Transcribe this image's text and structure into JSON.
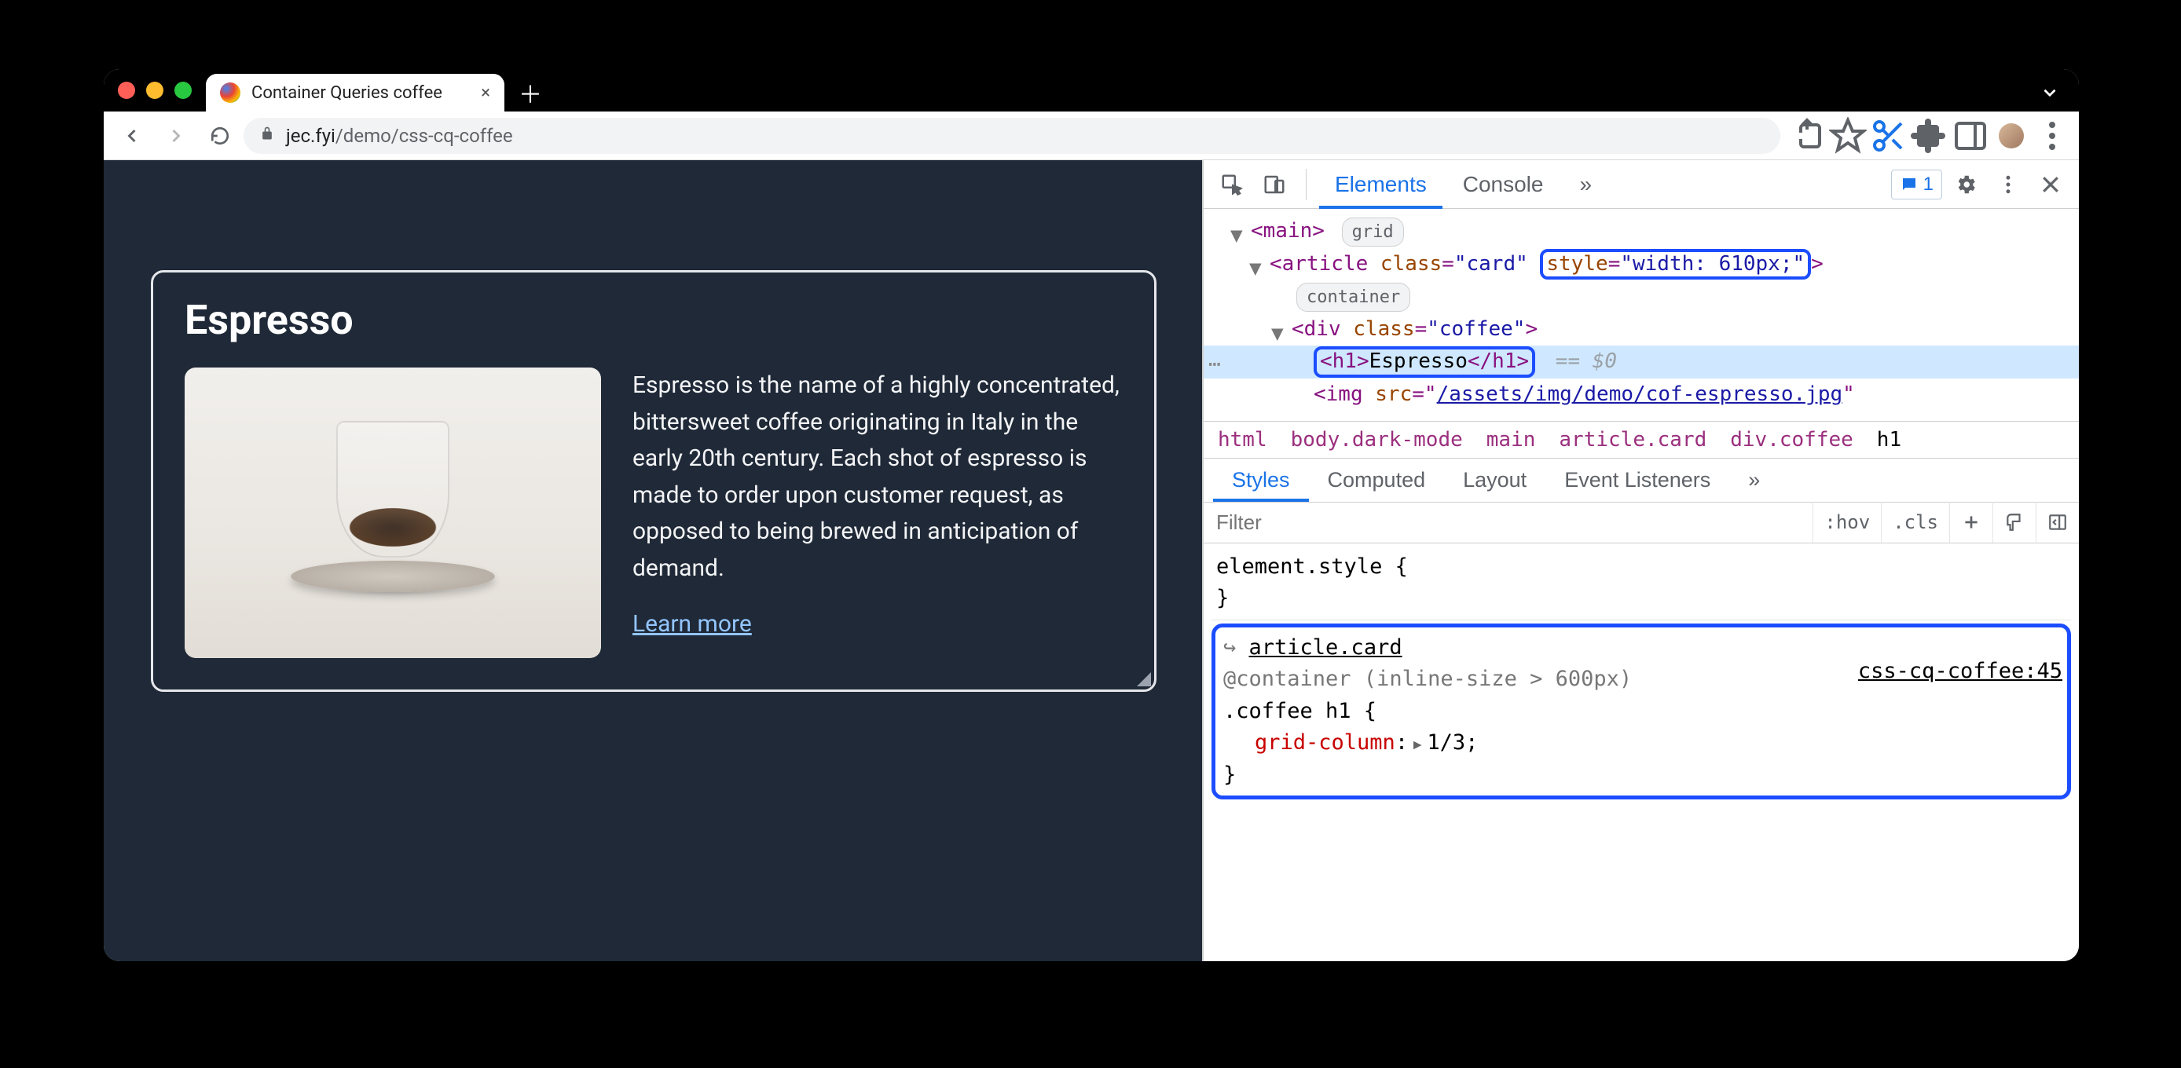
{
  "tab": {
    "title": "Container Queries coffee"
  },
  "addressbar": {
    "domain": "jec.fyi",
    "path": "/demo/css-cq-coffee"
  },
  "page": {
    "card_title": "Espresso",
    "card_body": "Espresso is the name of a highly concentrated, bittersweet coffee originating in Italy in the early 20th century. Each shot of espresso is made to order upon customer request, as opposed to being brewed in anticipation of demand.",
    "learn_more": "Learn more"
  },
  "devtools": {
    "tabs": {
      "elements": "Elements",
      "console": "Console",
      "more": "»"
    },
    "issues_count": "1",
    "dom": {
      "main_tag": "main",
      "main_badge": "grid",
      "article_open_a": "<article ",
      "article_class_attr": "class",
      "article_class_val": "\"card\"",
      "article_style_attr": "style",
      "article_style_val": "\"width: 610px;\"",
      "article_open_b": ">",
      "article_badge": "container",
      "div_open": "<div class=\"coffee\">",
      "h1_full": "<h1>Espresso</h1>",
      "eq0": "== $0",
      "img_a": "<img ",
      "img_attr": "src",
      "img_val": "/assets/img/demo/cof-espresso.jpg",
      "img_b": "\""
    },
    "breadcrumbs": [
      "html",
      "body.dark-mode",
      "main",
      "article.card",
      "div.coffee",
      "h1"
    ],
    "styles_tabs": {
      "styles": "Styles",
      "computed": "Computed",
      "layout": "Layout",
      "event": "Event Listeners",
      "more": "»"
    },
    "filter": {
      "placeholder": "Filter",
      "hov": ":hov",
      "cls": ".cls"
    },
    "styles": {
      "element_style_line": "element.style {",
      "close_brace": "}",
      "container_link": "article.card",
      "container_arrow": "↪ ",
      "container_query": "@container (inline-size > 600px)",
      "selector": ".coffee h1 {",
      "prop": "grid-column",
      "val": "1/3",
      "source": "css-cq-coffee:45"
    }
  }
}
